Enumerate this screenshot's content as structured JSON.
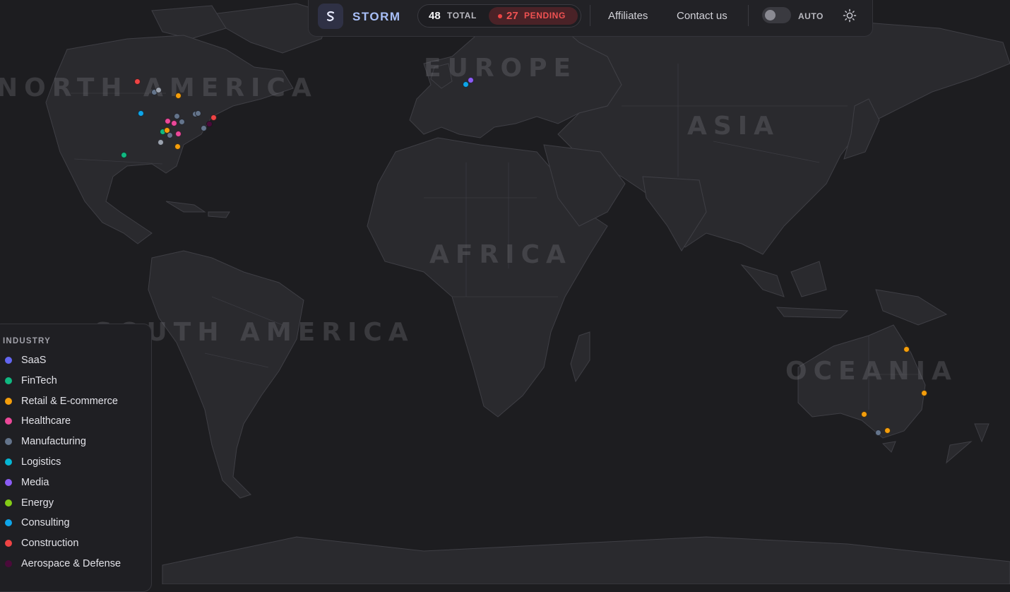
{
  "header": {
    "brand": "STORM",
    "logo_icon": "storm-logo-icon",
    "total_count": "48",
    "total_label": "TOTAL",
    "pending_count": "27",
    "pending_label": "PENDING",
    "nav": [
      "Affiliates",
      "Contact us"
    ],
    "auto_label": "AUTO",
    "theme_icon": "sun-icon",
    "pending_color": "#ef4444",
    "brand_color": "#a8bff7"
  },
  "map": {
    "continents": [
      "NORTH AMERICA",
      "EUROPE",
      "ASIA",
      "AFRICA",
      "SOUTH AMERICA",
      "OCEANIA"
    ]
  },
  "legend": {
    "title": "INDUSTRY",
    "items": [
      {
        "label": "SaaS",
        "color": "#6366f1"
      },
      {
        "label": "FinTech",
        "color": "#10b981"
      },
      {
        "label": "Retail & E-commerce",
        "color": "#f59e0b"
      },
      {
        "label": "Healthcare",
        "color": "#ec4899"
      },
      {
        "label": "Manufacturing",
        "color": "#64748b"
      },
      {
        "label": "Logistics",
        "color": "#06b6d4"
      },
      {
        "label": "Media",
        "color": "#8b5cf6"
      },
      {
        "label": "Energy",
        "color": "#84cc16"
      },
      {
        "label": "Consulting",
        "color": "#0ea5e9"
      },
      {
        "label": "Construction",
        "color": "#ef4444"
      },
      {
        "label": "Aerospace & Defense",
        "color": "#4a0a3a"
      }
    ]
  }
}
